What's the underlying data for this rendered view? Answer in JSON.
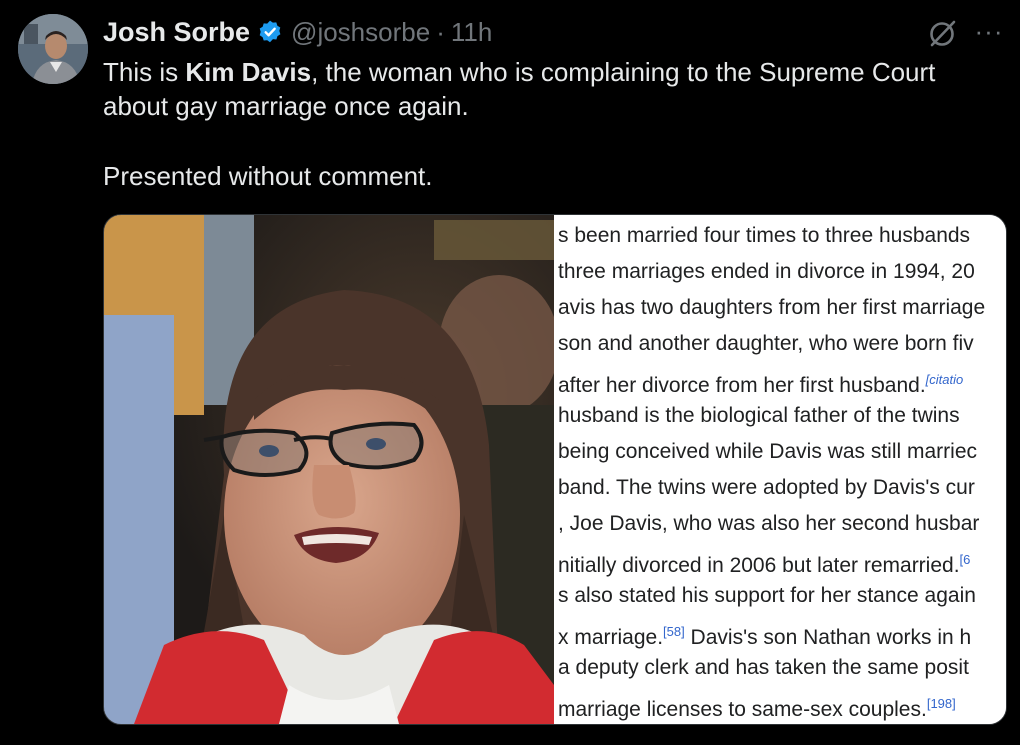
{
  "author": {
    "name": "Josh Sorbe",
    "handle": "@joshsorbe",
    "separator": "·",
    "time": "11h"
  },
  "tweet": {
    "line1_prefix": "This is ",
    "line1_bold": "Kim Davis",
    "line1_suffix": ", the woman who is complaining to the Supreme Court",
    "line2": "about gay marriage once again.",
    "line3": "Presented without comment."
  },
  "actions": {
    "more_label": "···",
    "grok_icon": "grok-icon"
  },
  "wiki_excerpt": [
    {
      "text": "s been married four times to three husbands",
      "ref": ""
    },
    {
      "text": " three marriages ended in divorce in 1994, 20",
      "ref": ""
    },
    {
      "text": "avis has two daughters from her first marriage",
      "ref": ""
    },
    {
      "text": "son and another daughter, who were born fiv",
      "ref": ""
    },
    {
      "text": "after her divorce from her first husband.",
      "ref": "[citatio"
    },
    {
      "text": " husband is the biological father of the twins",
      "ref": ""
    },
    {
      "text": " being conceived while Davis was still marriec",
      "ref": ""
    },
    {
      "text": "band. The twins were adopted by Davis's cur",
      "ref": ""
    },
    {
      "text": ", Joe Davis, who was also her second husbar",
      "ref": ""
    },
    {
      "text": "nitially divorced in 2006 but later remarried.",
      "ref": "[6"
    },
    {
      "text": "s also stated his support for her stance again",
      "ref": ""
    },
    {
      "text": "x marriage.",
      "ref": "[58]",
      "after": " Davis's son Nathan works in h"
    },
    {
      "text": " a deputy clerk and has taken the same posit",
      "ref": ""
    },
    {
      "text": "marriage licenses to same-sex couples.",
      "ref": "[198]"
    }
  ],
  "colors": {
    "background": "#000000",
    "text": "#e7e9ea",
    "muted": "#71767b",
    "verified": "#1d9bf0",
    "wiki_link": "#3366cc"
  }
}
